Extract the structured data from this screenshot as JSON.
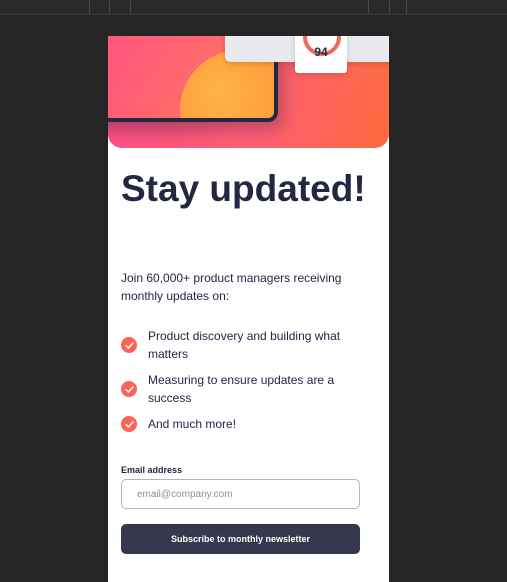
{
  "hero": {
    "score": "94"
  },
  "content": {
    "title": "Stay updated!",
    "intro": "Join 60,000+ product managers receiving monthly updates on:",
    "benefits": [
      "Product discovery and building what matters",
      "Measuring to ensure updates are a success",
      "And much more!"
    ]
  },
  "form": {
    "email_label": "Email address",
    "email_placeholder": "email@company.com",
    "email_value": "",
    "subscribe_label": "Subscribe to monthly newsletter"
  },
  "colors": {
    "page_background": "#252525",
    "card_background": "#ffffff",
    "text_primary": "#242742",
    "accent_tomato": "#ff6155",
    "button_background": "#36384d",
    "hero_gradient_start": "#ff4f86",
    "hero_gradient_end": "#ff6a3d"
  },
  "icons": {
    "benefit": "check-circle-icon"
  }
}
